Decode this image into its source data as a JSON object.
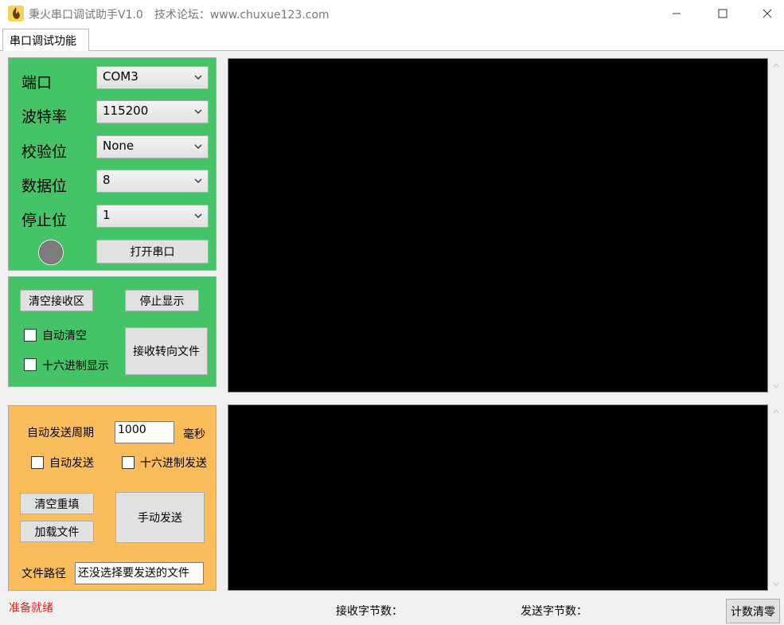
{
  "window": {
    "title": "秉火串口调试助手V1.0",
    "forum": "技术论坛：www.chuxue123.com",
    "minimize_glyph": "—",
    "maximize_glyph": "☐",
    "close_glyph": "✕",
    "app_icon": "flame-app-icon"
  },
  "tabs": [
    {
      "label": "串口调试功能"
    }
  ],
  "serial": {
    "port": {
      "label": "端口",
      "value": "COM3"
    },
    "baud": {
      "label": "波特率",
      "value": "115200"
    },
    "parity": {
      "label": "校验位",
      "value": "None"
    },
    "databits": {
      "label": "数据位",
      "value": "8"
    },
    "stopbits": {
      "label": "停止位",
      "value": "1"
    },
    "open_button": "打开串口",
    "led_color": "#7d7d7d"
  },
  "receive": {
    "clear_button": "清空接收区",
    "stop_button": "停止显示",
    "auto_clear_label": "自动清空",
    "hex_display_label": "十六进制显示",
    "to_file_button": "接收转向文件"
  },
  "send": {
    "period_label": "自动发送周期",
    "period_value": "1000",
    "period_unit": "毫秒",
    "auto_send_label": "自动发送",
    "hex_send_label": "十六进制发送",
    "clear_refill_button": "清空重填",
    "load_file_button": "加载文件",
    "manual_send_button": "手动发送",
    "file_path_label": "文件路径",
    "file_path_value": "还没选择要发送的文件"
  },
  "status": {
    "ready": "准备就绪",
    "rx_count_label": "接收字节数：",
    "tx_count_label": "发送字节数：",
    "reset_button": "计数清零"
  },
  "colors": {
    "green_panel": "#44c467",
    "orange_panel": "#fbbd5c",
    "terminal": "#000000",
    "status_red": "#e8201a"
  }
}
